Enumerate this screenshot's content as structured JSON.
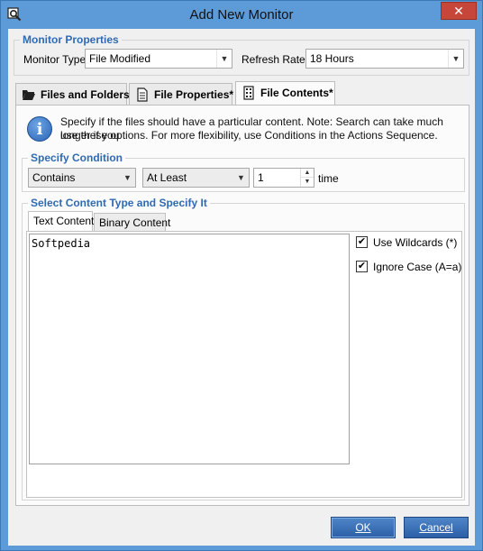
{
  "window": {
    "title": "Add New Monitor",
    "close_glyph": "✕",
    "title_icon": "monitor-search-icon"
  },
  "monitor_properties": {
    "legend": "Monitor Properties",
    "type_label": "Monitor Type:",
    "type_value": "File Modified",
    "rate_label": "Refresh Rate:",
    "rate_value": "18 Hours"
  },
  "tabs": [
    {
      "label": "Files and Folders",
      "icon": "folder-open-icon",
      "active": false
    },
    {
      "label": "File Properties*",
      "icon": "document-icon",
      "active": false
    },
    {
      "label": "File Contents*",
      "icon": "binary-file-icon",
      "active": true
    }
  ],
  "info": {
    "glyph": "i",
    "line1": "Specify if the files should have a particular content. Note: Search can take much longer if you",
    "line2": "use these options. For more flexibility, use Conditions in the Actions Sequence."
  },
  "specify_condition": {
    "legend": "Specify Condition",
    "condition_value": "Contains",
    "quantifier_value": "At Least",
    "count_value": "1",
    "unit_label": "time"
  },
  "content_type": {
    "legend": "Select Content Type and Specify It",
    "subtabs": [
      {
        "label": "Text Content",
        "active": true
      },
      {
        "label": "Binary Content",
        "active": false
      }
    ],
    "text_value": "Softpedia",
    "use_wildcards_label": "Use Wildcards (*)",
    "use_wildcards_checked": true,
    "ignore_case_label": "Ignore Case (A=a)",
    "ignore_case_checked": true,
    "check_glyph": "✔"
  },
  "buttons": {
    "ok_label": "OK",
    "cancel_label": "Cancel"
  },
  "colors": {
    "accent_blue": "#2f6ab2",
    "window_frame": "#5c9bd8",
    "close_red": "#c7463a"
  }
}
